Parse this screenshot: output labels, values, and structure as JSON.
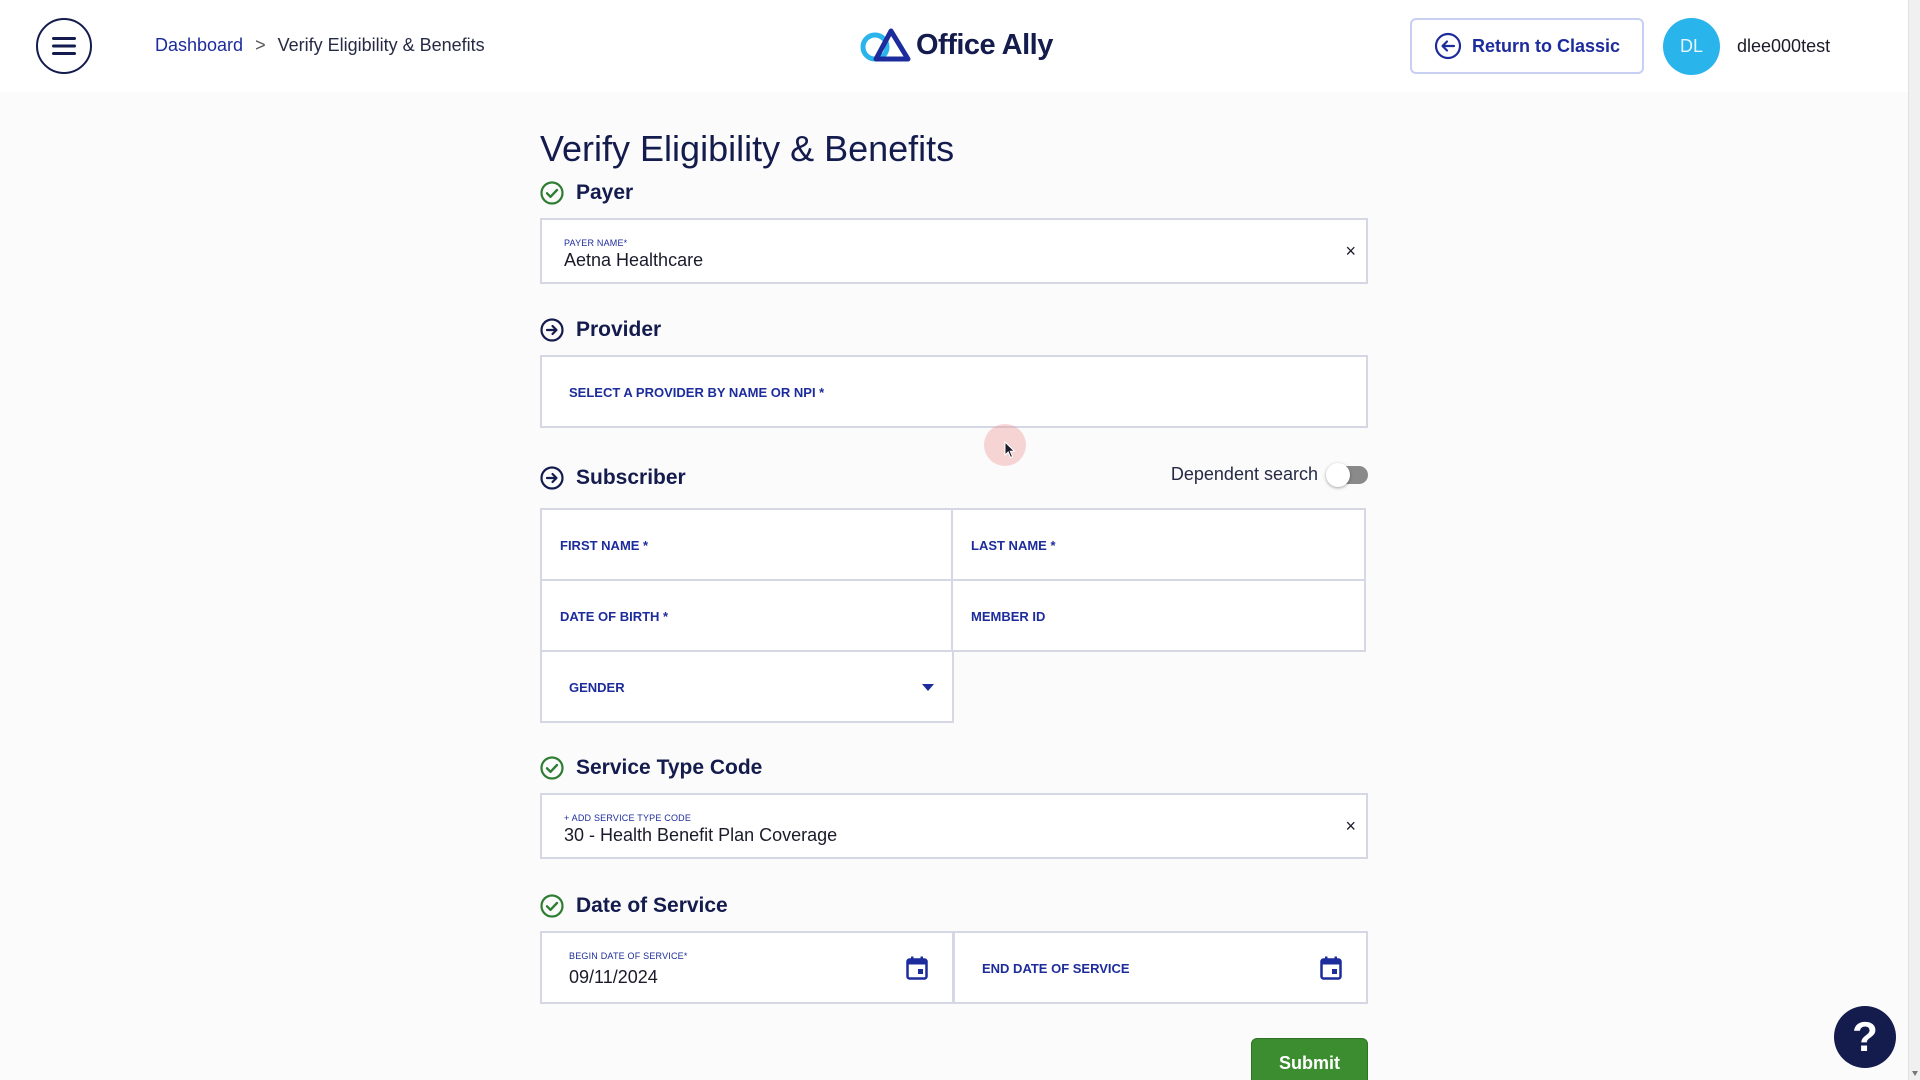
{
  "header": {
    "breadcrumb": {
      "home": "Dashboard",
      "separator": ">",
      "current": "Verify Eligibility & Benefits"
    },
    "logo_text": "Office Ally",
    "return_button": "Return to Classic",
    "avatar_initials": "DL",
    "username": "dlee000test"
  },
  "page": {
    "title": "Verify Eligibility & Benefits"
  },
  "payer": {
    "section_title": "Payer",
    "status_icon": "check-circle-icon",
    "field_label": "PAYER NAME*",
    "field_value": "Aetna Healthcare",
    "clear": "×"
  },
  "provider": {
    "section_title": "Provider",
    "status_icon": "arrow-right-circle-icon",
    "placeholder": "SELECT A PROVIDER BY NAME OR NPI *"
  },
  "subscriber": {
    "section_title": "Subscriber",
    "status_icon": "arrow-right-circle-icon",
    "dependent_label": "Dependent search",
    "dependent_on": false,
    "first_name": "FIRST NAME *",
    "last_name": "LAST NAME *",
    "dob": "DATE OF BIRTH *",
    "member_id": "MEMBER ID",
    "gender": "GENDER"
  },
  "service_type": {
    "section_title": "Service Type Code",
    "status_icon": "check-circle-icon",
    "field_label": "+ ADD SERVICE TYPE CODE",
    "field_value": "30 - Health Benefit Plan Coverage",
    "clear": "×"
  },
  "date_of_service": {
    "section_title": "Date of Service",
    "status_icon": "check-circle-icon",
    "begin_label": "BEGIN DATE OF SERVICE*",
    "begin_value": "09/11/2024",
    "end_placeholder": "END DATE OF SERVICE"
  },
  "actions": {
    "submit": "Submit",
    "help": "?"
  },
  "colors": {
    "navy": "#141b4d",
    "link_blue": "#1d2c9c",
    "success_green": "#2e7d32",
    "submit_green": "#3c8d2f",
    "avatar_blue": "#2ab4ec"
  }
}
